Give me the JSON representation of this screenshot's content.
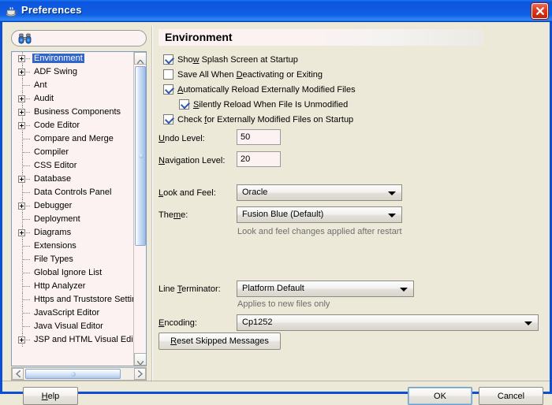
{
  "window": {
    "title": "Preferences",
    "title_icon": "java-coffee-cup-icon",
    "close_icon": "close-icon",
    "titlebar_color": "#0f5ae0",
    "close_color": "#c22208"
  },
  "sidebar": {
    "search": {
      "placeholder": "",
      "value": "",
      "icon": "binoculars-search-icon"
    },
    "selection_color": "#3165c8",
    "tree": [
      {
        "label": "Environment",
        "expandable": true,
        "selected": true
      },
      {
        "label": "ADF Swing",
        "expandable": true,
        "selected": false
      },
      {
        "label": "Ant",
        "expandable": false,
        "selected": false
      },
      {
        "label": "Audit",
        "expandable": true,
        "selected": false
      },
      {
        "label": "Business Components",
        "expandable": true,
        "selected": false
      },
      {
        "label": "Code Editor",
        "expandable": true,
        "selected": false
      },
      {
        "label": "Compare and Merge",
        "expandable": false,
        "selected": false
      },
      {
        "label": "Compiler",
        "expandable": false,
        "selected": false
      },
      {
        "label": "CSS Editor",
        "expandable": false,
        "selected": false
      },
      {
        "label": "Database",
        "expandable": true,
        "selected": false
      },
      {
        "label": "Data Controls Panel",
        "expandable": false,
        "selected": false
      },
      {
        "label": "Debugger",
        "expandable": true,
        "selected": false
      },
      {
        "label": "Deployment",
        "expandable": false,
        "selected": false
      },
      {
        "label": "Diagrams",
        "expandable": true,
        "selected": false
      },
      {
        "label": "Extensions",
        "expandable": false,
        "selected": false
      },
      {
        "label": "File Types",
        "expandable": false,
        "selected": false
      },
      {
        "label": "Global Ignore List",
        "expandable": false,
        "selected": false
      },
      {
        "label": "Http Analyzer",
        "expandable": false,
        "selected": false
      },
      {
        "label": "Https and Truststore Settin",
        "expandable": false,
        "selected": false
      },
      {
        "label": "JavaScript Editor",
        "expandable": false,
        "selected": false
      },
      {
        "label": "Java Visual Editor",
        "expandable": false,
        "selected": false
      },
      {
        "label": "JSP and HTML Visual Editor",
        "expandable": true,
        "selected": false
      }
    ]
  },
  "panel": {
    "header": "Environment",
    "checkboxes": [
      {
        "label": "Show Splash Screen at Startup",
        "checked": true,
        "mnemonic": "w",
        "indent": false
      },
      {
        "label": "Save All When Deactivating or Exiting",
        "checked": false,
        "mnemonic": "D",
        "indent": false
      },
      {
        "label": "Automatically Reload Externally Modified Files",
        "checked": true,
        "mnemonic": "A",
        "indent": false
      },
      {
        "label": "Silently Reload When File Is Unmodified",
        "checked": true,
        "mnemonic": "S",
        "indent": true
      },
      {
        "label": "Check for Externally Modified Files on Startup",
        "checked": true,
        "mnemonic": "f",
        "indent": false
      }
    ],
    "undo": {
      "label": "Undo Level:",
      "value": "50"
    },
    "navigation": {
      "label": "Navigation Level:",
      "value": "20"
    },
    "look_and_feel": {
      "label": "Look and Feel:",
      "value": "Oracle"
    },
    "theme": {
      "label": "Theme:",
      "value": "Fusion Blue (Default)"
    },
    "theme_hint": "Look and feel changes applied after restart",
    "line_terminator": {
      "label": "Line Terminator:",
      "value": "Platform Default"
    },
    "line_terminator_hint": "Applies to new files only",
    "encoding": {
      "label": "Encoding:",
      "value": "Cp1252"
    },
    "reset_button": "Reset Skipped Messages"
  },
  "footer": {
    "help": "Help",
    "ok": "OK",
    "cancel": "Cancel"
  }
}
